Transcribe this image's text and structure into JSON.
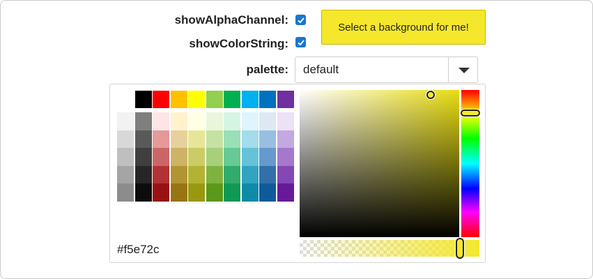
{
  "options": {
    "show_alpha_label": "showAlphaChannel:",
    "show_alpha_checked": true,
    "show_color_string_label": "showColorString:",
    "show_color_string_checked": true,
    "palette_label": "palette:",
    "palette_value": "default"
  },
  "background_button": {
    "label": "Select a background for me!",
    "color": "#f5e72c"
  },
  "picker": {
    "hex_value": "#f5e72c",
    "selected_color": "#f5e72c",
    "alpha_fraction": 1.0,
    "palette_top_row": [
      "#ffffff",
      "#000000",
      "#ff0000",
      "#ffc000",
      "#ffff00",
      "#92d050",
      "#00b050",
      "#00b0f0",
      "#0070c0",
      "#7030a0"
    ],
    "palette_shades": [
      [
        "#f2f2f2",
        "#7f7f7f",
        "#ffe5e5",
        "#fff2cc",
        "#ffffe5",
        "#eaf6dc",
        "#d5f5e3",
        "#dff4fc",
        "#dce9f5",
        "#ece1f5"
      ],
      [
        "#d8d8d8",
        "#595959",
        "#e59999",
        "#e6d19c",
        "#e6e699",
        "#c5e2a3",
        "#99dfb8",
        "#a3dceb",
        "#99bfe0",
        "#c4a8e0"
      ],
      [
        "#bfbfbf",
        "#3f3f3f",
        "#cc6666",
        "#ccb366",
        "#cccc66",
        "#a8d07a",
        "#66c996",
        "#66c2d9",
        "#6699cc",
        "#a578cc"
      ],
      [
        "#a5a5a5",
        "#262626",
        "#b23333",
        "#b39433",
        "#b3b333",
        "#7fb33f",
        "#33aa6e",
        "#33a3c2",
        "#336fa8",
        "#8447b3"
      ],
      [
        "#8c8c8c",
        "#0c0c0c",
        "#991111",
        "#997411",
        "#999911",
        "#5a991a",
        "#0f9955",
        "#0f8aa8",
        "#0f5a99",
        "#661a99"
      ]
    ]
  }
}
